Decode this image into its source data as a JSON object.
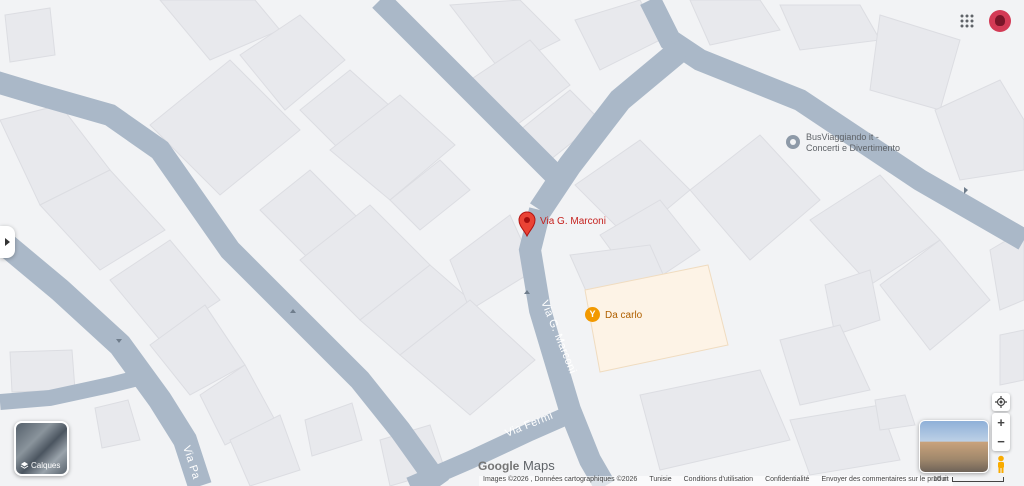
{
  "streets": {
    "marconi_vertical": "Via G. Marconi",
    "fermi": "Via Fermi",
    "pa_partial": "Via Pa"
  },
  "pin": {
    "label": "Via G. Marconi",
    "color": "#ea4335"
  },
  "pois": {
    "bus": {
      "line1": "BusViaggiando it -",
      "line2": "Concerti e Divertimento",
      "icon": "poi-circle-icon"
    },
    "restaurant": {
      "label": "Da carlo",
      "glyph": "Y",
      "icon": "restaurant-icon",
      "color": "#f29900"
    }
  },
  "layers": {
    "label": "Calques",
    "icon": "layers-icon"
  },
  "controls": {
    "zoom_in": "+",
    "zoom_out": "−",
    "locate_icon": "my-location-icon",
    "pegman_icon": "pegman-icon",
    "apps_icon": "apps-grid-icon"
  },
  "branding": {
    "google": "Google",
    "maps": "Maps"
  },
  "footer": {
    "imagery": "Images ©2026 , Données cartographiques ©2026",
    "country": "Tunisie",
    "terms": "Conditions d'utilisation",
    "privacy": "Confidentialité",
    "feedback": "Envoyer des commentaires sur le produit",
    "scale": "10 m"
  },
  "colors": {
    "road": "#aab8c8",
    "building": "#e8e9ed",
    "land": "#f2f3f5",
    "poi_area": "#fdf3e6"
  }
}
